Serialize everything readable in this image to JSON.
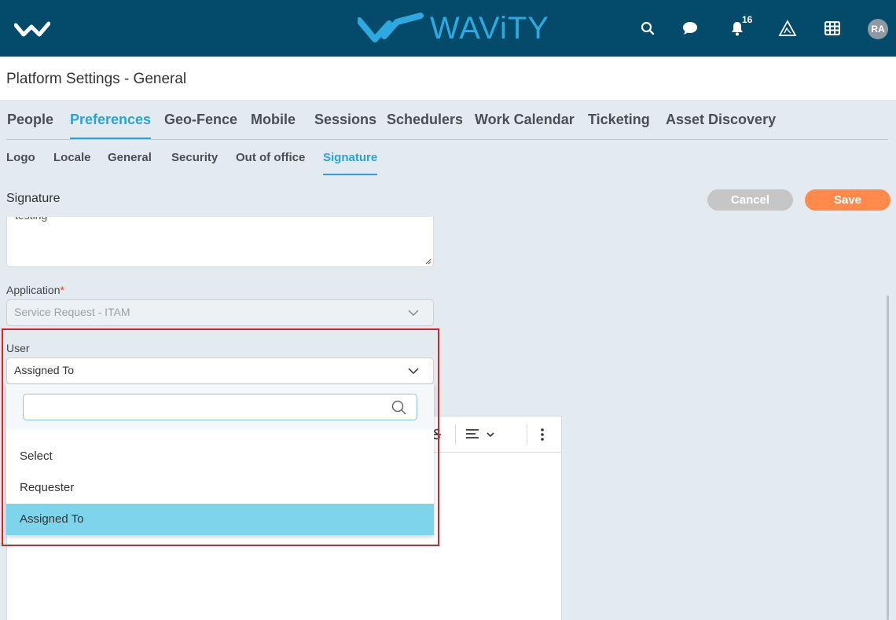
{
  "header": {
    "brand": "WAViTY",
    "notification_count": "16",
    "avatar_initials": "RA",
    "colors": {
      "bar": "#034a6b",
      "accent": "#2ba3d6"
    },
    "icons": [
      "wavity-logo-icon",
      "search-icon",
      "chat-icon",
      "bell-icon",
      "alert-triangle-icon",
      "grid-icon"
    ]
  },
  "page": {
    "title": "Platform Settings - General"
  },
  "main_tabs": [
    {
      "label": "People"
    },
    {
      "label": "Preferences",
      "active": true
    },
    {
      "label": "Geo-Fence"
    },
    {
      "label": "Mobile"
    },
    {
      "label": "Sessions"
    },
    {
      "label": "Schedulers"
    },
    {
      "label": "Work Calendar"
    },
    {
      "label": "Ticketing"
    },
    {
      "label": "Asset Discovery"
    }
  ],
  "sub_tabs": [
    {
      "label": "Logo"
    },
    {
      "label": "Locale"
    },
    {
      "label": "General"
    },
    {
      "label": "Security"
    },
    {
      "label": "Out of office"
    },
    {
      "label": "Signature",
      "active": true
    }
  ],
  "section": {
    "title": "Signature",
    "cancel_label": "Cancel",
    "save_label": "Save",
    "textarea_text": "testing"
  },
  "application_field": {
    "label": "Application",
    "required_mark": "*",
    "value": "Service Request - ITAM"
  },
  "user_field": {
    "label": "User",
    "value": "Assigned To",
    "search_value": "",
    "options": [
      {
        "label": "Select"
      },
      {
        "label": "Requester"
      },
      {
        "label": "Assigned To",
        "selected": true
      }
    ]
  }
}
